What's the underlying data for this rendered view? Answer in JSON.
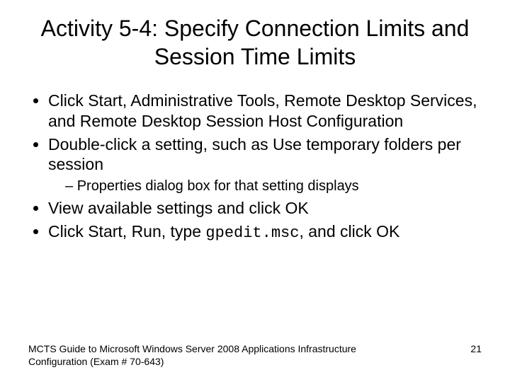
{
  "title": "Activity 5-4: Specify Connection Limits and Session Time Limits",
  "bullets": {
    "b1": "Click Start, Administrative Tools, Remote Desktop Services, and Remote Desktop Session Host Configuration",
    "b2": "Double-click a setting, such as Use temporary folders per session",
    "b2_sub": "Properties dialog box for that setting displays",
    "b3": "View available settings and click OK",
    "b4_pre": "Click Start, Run, type ",
    "b4_code": "gpedit.msc",
    "b4_post": ", and click OK"
  },
  "footer": "MCTS Guide to Microsoft Windows Server 2008 Applications Infrastructure Configuration (Exam # 70-643)",
  "page": "21"
}
